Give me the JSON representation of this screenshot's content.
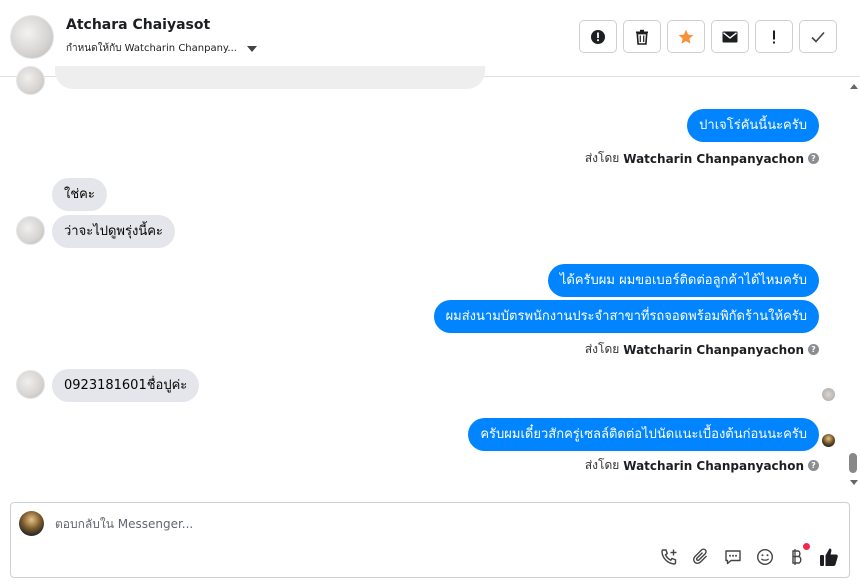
{
  "header": {
    "contact_name": "Atchara Chaiyasot",
    "assigned_text": "กำหนดให้กับ Watcharin Chanpany..."
  },
  "actions": [
    {
      "name": "spam-icon"
    },
    {
      "name": "trash-icon"
    },
    {
      "name": "star-icon",
      "color": "#f7923b"
    },
    {
      "name": "envelope-icon"
    },
    {
      "name": "exclamation-icon"
    },
    {
      "name": "check-icon"
    }
  ],
  "messages": {
    "out_1": "ปาเจโร่คันนี้นะครับ",
    "sent_by_prefix": "ส่งโดย",
    "sent_by_name": "Watcharin Chanpanyachon",
    "in_1": "ใช่คะ",
    "in_2": "ว่าจะไปดูพรุ่งนี้คะ",
    "out_2": "ได้ครับผม ผมขอเบอร์ติดต่อลูกค้าได้ไหมครับ",
    "out_3": "ผมส่งนามบัตรพนักงานประจำสาขาที่รถจอดพร้อมพิกัดร้านให้ครับ",
    "in_3": "0923181601ชื่อปูค่ะ",
    "out_4": "ครับผมเดี๋ยวสักครู่เซลล์ติดต่อไปนัดแนะเบื้องต้นก่อนนะครับ"
  },
  "composer": {
    "placeholder": "ตอบกลับใน Messenger..."
  },
  "colors": {
    "outgoing_bubble": "#0084ff",
    "incoming_bubble": "#e4e6eb",
    "like_icon": "#1c1e21",
    "notification_dot": "#f02849"
  }
}
